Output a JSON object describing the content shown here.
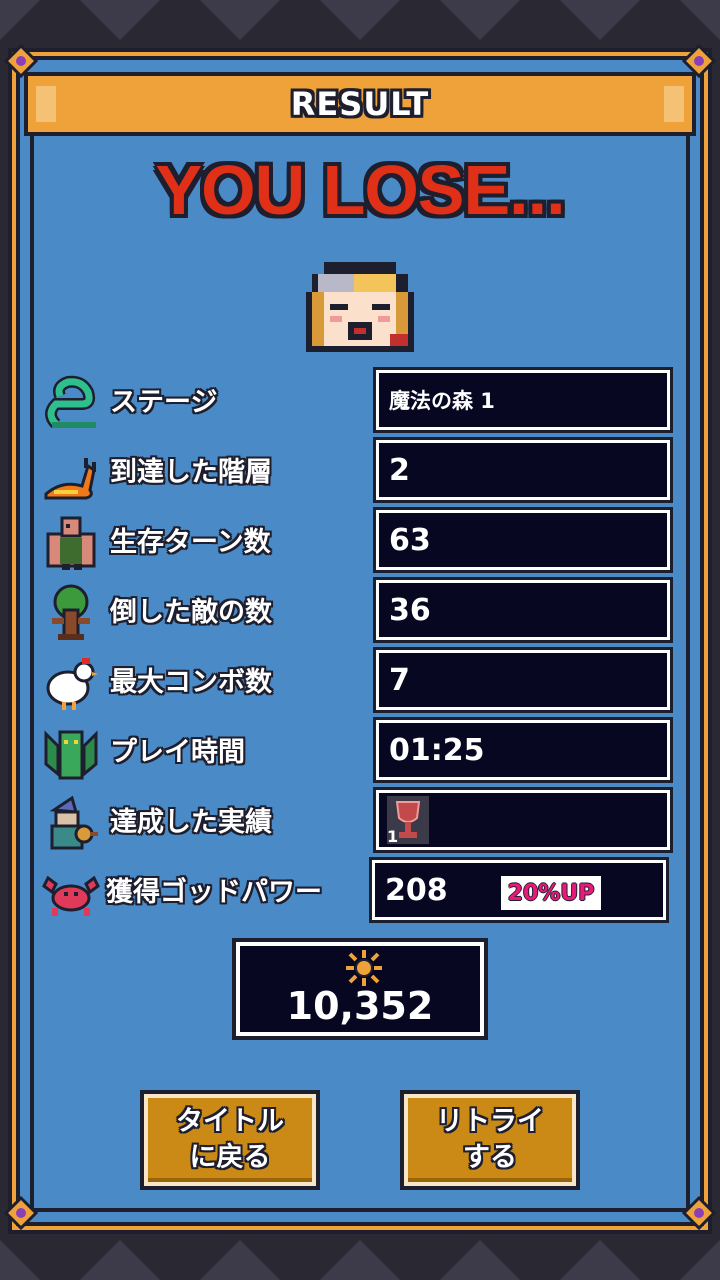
{
  "header": {
    "title": "RESULT"
  },
  "result": {
    "headline": "YOU LOSE..."
  },
  "stats": [
    {
      "icon": "snake-icon",
      "label": "ステージ",
      "value": "魔法の森 1"
    },
    {
      "icon": "slug-icon",
      "label": "到達した階層",
      "value": "2"
    },
    {
      "icon": "ogre-icon",
      "label": "生存ターン数",
      "value": "63"
    },
    {
      "icon": "tree-monster-icon",
      "label": "倒した敵の数",
      "value": "36"
    },
    {
      "icon": "chicken-icon",
      "label": "最大コンボ数",
      "value": "7"
    },
    {
      "icon": "gargoyle-icon",
      "label": "プレイ時間",
      "value": "01:25"
    },
    {
      "icon": "wizard-icon",
      "label": "達成した実績",
      "value": ""
    },
    {
      "icon": "crab-icon",
      "label": "獲得ゴッドパワー",
      "value": "208"
    }
  ],
  "achievement": {
    "count": "1"
  },
  "god_power_bonus": "20%UP",
  "score": {
    "value": "10,352"
  },
  "buttons": {
    "title": "タイトル\nに戻る",
    "retry": "リトライ\nする"
  },
  "colors": {
    "panel": "#4a8ac7",
    "title_bar": "#f0a23a",
    "lose": "#e03118",
    "button": "#cb8a16",
    "badge_text": "#e8197b"
  }
}
